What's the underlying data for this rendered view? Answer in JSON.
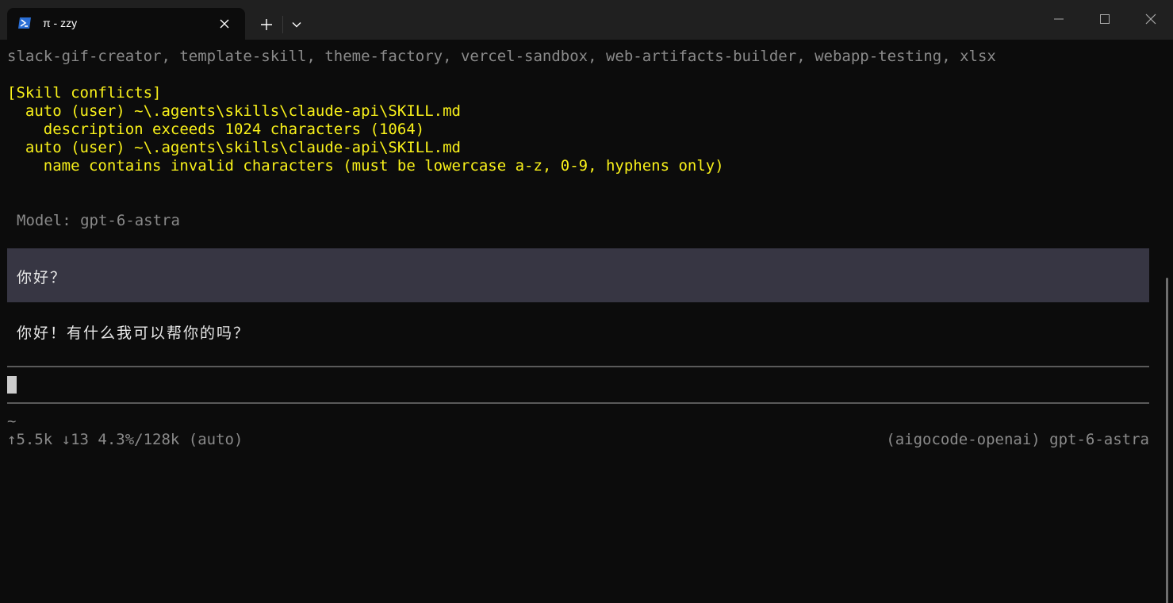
{
  "tab": {
    "title": "π - zzy",
    "icon": "powershell-icon"
  },
  "window_controls": {
    "new_tab": "+",
    "dropdown": "chevron-down-icon",
    "minimize": "minimize-icon",
    "maximize": "maximize-icon",
    "close": "close-icon"
  },
  "terminal": {
    "skills_line": "slack-gif-creator, template-skill, theme-factory, vercel-sandbox, web-artifacts-builder, webapp-testing, xlsx",
    "conflicts_header": "[Skill conflicts]",
    "conflicts": [
      {
        "path": "  auto (user) ~\\.agents\\skills\\claude-api\\SKILL.md",
        "detail": "    description exceeds 1024 characters (1064)"
      },
      {
        "path": "  auto (user) ~\\.agents\\skills\\claude-api\\SKILL.md",
        "detail": "    name contains invalid characters (must be lowercase a-z, 0-9, hyphens only)"
      }
    ],
    "model_line": "Model: gpt-6-astra",
    "user_message": "你好？",
    "assistant_reply": "你好！有什么我可以帮你的吗？",
    "cwd": "~",
    "stats_left": "↑5.5k ↓13 4.3%/128k (auto)",
    "stats_right": "(aigocode-openai) gpt-6-astra"
  },
  "colors": {
    "background": "#0c0c0c",
    "titlebar": "#202020",
    "warning_text": "#f9f11a",
    "dim_text": "#8a8a8a",
    "user_message_bg": "#373643"
  }
}
